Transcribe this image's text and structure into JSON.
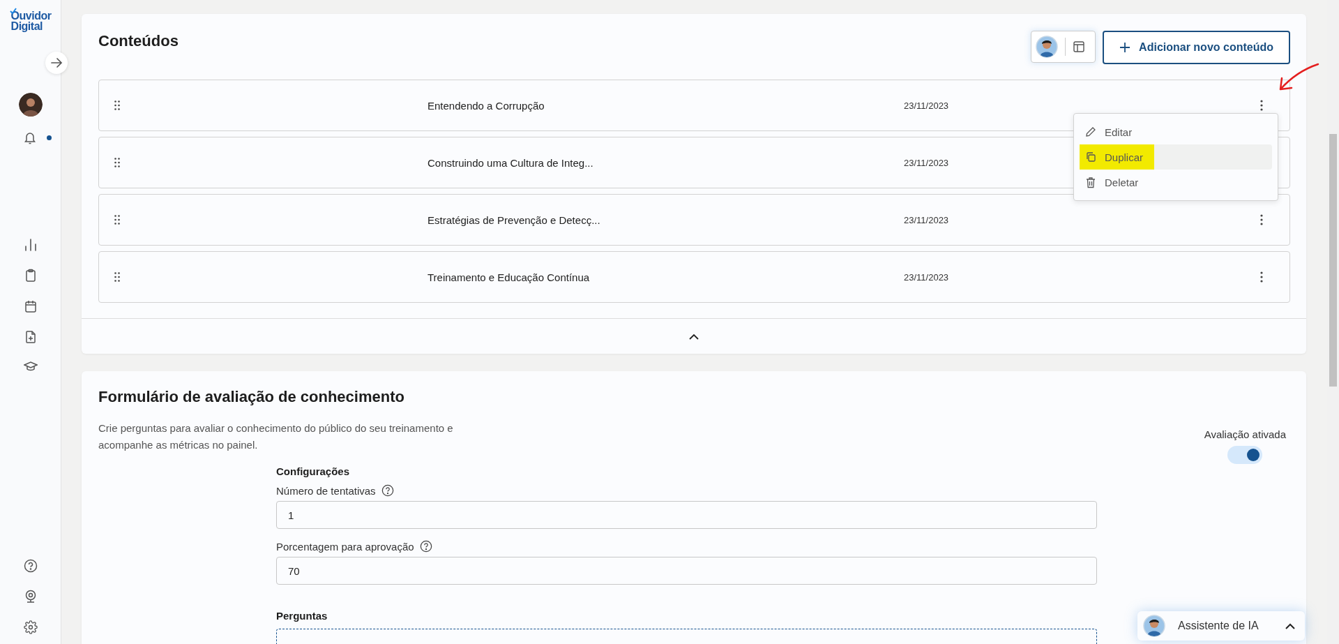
{
  "sidebar": {
    "logo": [
      "Ouvidor",
      "Digital"
    ],
    "notification_dot": true,
    "nav": [
      {
        "kind": "chart"
      },
      {
        "kind": "clipboard"
      },
      {
        "kind": "calendar"
      },
      {
        "kind": "file-plus"
      },
      {
        "kind": "graduation"
      }
    ],
    "bottom_nav": [
      {
        "kind": "help"
      },
      {
        "kind": "webcam"
      },
      {
        "kind": "settings"
      }
    ]
  },
  "contents": {
    "title": "Conteúdos",
    "add_button": "Adicionar novo conteúdo",
    "rows": [
      {
        "title": "Entendendo a Corrupção",
        "date": "23/11/2023",
        "menu_open": true
      },
      {
        "title": "Construindo uma Cultura de Integ...",
        "date": "23/11/2023",
        "menu_open": false
      },
      {
        "title": "Estratégias de Prevenção e Detecç...",
        "date": "23/11/2023",
        "menu_open": false
      },
      {
        "title": "Treinamento e Educação Contínua",
        "date": "23/11/2023",
        "menu_open": false
      }
    ],
    "menu": [
      {
        "kind": "edit",
        "label": "Editar",
        "hovered": false,
        "marked": false
      },
      {
        "kind": "copy",
        "label": "Duplicar",
        "hovered": true,
        "marked": true
      },
      {
        "kind": "trash",
        "label": "Deletar",
        "hovered": false,
        "marked": false
      }
    ],
    "annotation": {
      "kind": "arrow"
    }
  },
  "form": {
    "title": "Formulário de avaliação de conhecimento",
    "description": "Crie perguntas para avaliar o conhecimento do público do seu treinamento e acompanhe as métricas no painel.",
    "toggle": {
      "label": "Avaliação ativada",
      "on": true
    },
    "settings_title": "Configurações",
    "fields": [
      {
        "label": "Número de tentativas",
        "value": "1"
      },
      {
        "label": "Porcentagem para aprovação",
        "value": "70"
      }
    ],
    "questions_title": "Perguntas"
  },
  "assistant": {
    "label": "Assistente de IA"
  }
}
